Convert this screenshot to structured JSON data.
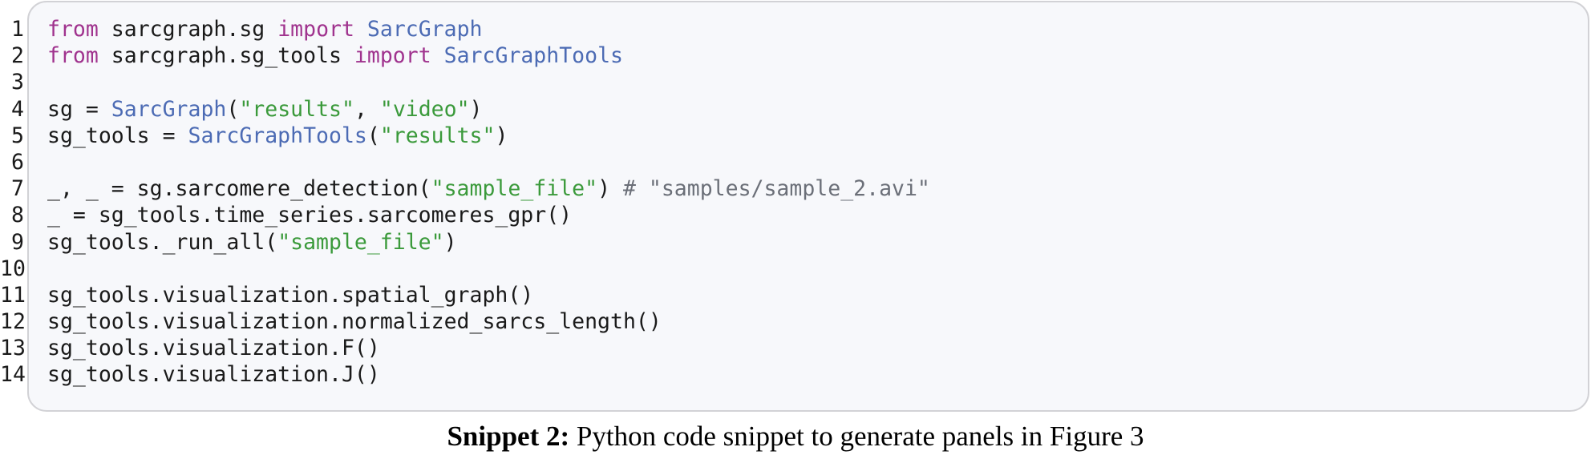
{
  "snippet": {
    "lines": [
      {
        "number": "1",
        "tokens": [
          {
            "kind": "kw",
            "text": "from"
          },
          {
            "kind": "txt",
            "text": " sarcgraph.sg "
          },
          {
            "kind": "kw",
            "text": "import"
          },
          {
            "kind": "txt",
            "text": " "
          },
          {
            "kind": "cls",
            "text": "SarcGraph"
          }
        ]
      },
      {
        "number": "2",
        "tokens": [
          {
            "kind": "kw",
            "text": "from"
          },
          {
            "kind": "txt",
            "text": " sarcgraph.sg_tools "
          },
          {
            "kind": "kw",
            "text": "import"
          },
          {
            "kind": "txt",
            "text": " "
          },
          {
            "kind": "cls",
            "text": "SarcGraphTools"
          }
        ]
      },
      {
        "number": "3",
        "tokens": []
      },
      {
        "number": "4",
        "tokens": [
          {
            "kind": "txt",
            "text": "sg = "
          },
          {
            "kind": "cls",
            "text": "SarcGraph"
          },
          {
            "kind": "txt",
            "text": "("
          },
          {
            "kind": "str",
            "text": "\"results\""
          },
          {
            "kind": "txt",
            "text": ", "
          },
          {
            "kind": "str",
            "text": "\"video\""
          },
          {
            "kind": "txt",
            "text": ")"
          }
        ]
      },
      {
        "number": "5",
        "tokens": [
          {
            "kind": "txt",
            "text": "sg_tools = "
          },
          {
            "kind": "cls",
            "text": "SarcGraphTools"
          },
          {
            "kind": "txt",
            "text": "("
          },
          {
            "kind": "str",
            "text": "\"results\""
          },
          {
            "kind": "txt",
            "text": ")"
          }
        ]
      },
      {
        "number": "6",
        "tokens": []
      },
      {
        "number": "7",
        "tokens": [
          {
            "kind": "txt",
            "text": "_, _ = sg.sarcomere_detection("
          },
          {
            "kind": "str",
            "text": "\"sample_file\""
          },
          {
            "kind": "txt",
            "text": ") "
          },
          {
            "kind": "com",
            "text": "# \"samples/sample_2.avi\""
          }
        ]
      },
      {
        "number": "8",
        "tokens": [
          {
            "kind": "txt",
            "text": "_ = sg_tools.time_series.sarcomeres_gpr()"
          }
        ]
      },
      {
        "number": "9",
        "tokens": [
          {
            "kind": "txt",
            "text": "sg_tools._run_all("
          },
          {
            "kind": "str",
            "text": "\"sample_file\""
          },
          {
            "kind": "txt",
            "text": ")"
          }
        ]
      },
      {
        "number": "10",
        "tokens": []
      },
      {
        "number": "11",
        "tokens": [
          {
            "kind": "txt",
            "text": "sg_tools.visualization.spatial_graph()"
          }
        ]
      },
      {
        "number": "12",
        "tokens": [
          {
            "kind": "txt",
            "text": "sg_tools.visualization.normalized_sarcs_length()"
          }
        ]
      },
      {
        "number": "13",
        "tokens": [
          {
            "kind": "txt",
            "text": "sg_tools.visualization.F()"
          }
        ]
      },
      {
        "number": "14",
        "tokens": [
          {
            "kind": "txt",
            "text": "sg_tools.visualization.J()"
          }
        ]
      }
    ]
  },
  "caption": {
    "label": "Snippet 2:",
    "text": " Python code snippet to generate panels in Figure 3"
  },
  "colors": {
    "keyword": "#a0338e",
    "class_name": "#4c6bb4",
    "string": "#3b9a3b",
    "comment": "#6b6f78",
    "frame_border": "#d2d2d6",
    "frame_background": "#f7f8fb"
  }
}
